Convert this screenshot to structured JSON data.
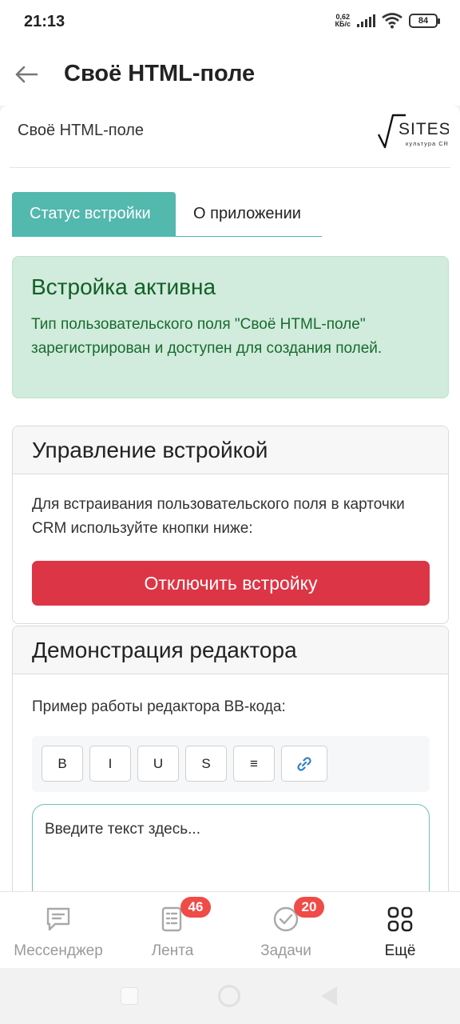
{
  "status_bar": {
    "time": "21:13",
    "net_speed_value": "0,62",
    "net_speed_unit": "КБ/с",
    "battery": "84"
  },
  "header": {
    "title": "Своё HTML-поле"
  },
  "app": {
    "name": "Своё HTML-поле",
    "logo_text": "SITES",
    "logo_subtext": "культура CRM"
  },
  "tabs": [
    {
      "label": "Статус встройки",
      "active": true
    },
    {
      "label": "О приложении",
      "active": false
    }
  ],
  "alert": {
    "title": "Встройка активна",
    "text": "Тип пользовательского поля \"Своё HTML-поле\" зарегистрирован и доступен для создания полей."
  },
  "manage_card": {
    "title": "Управление встройкой",
    "text": "Для встраивания пользовательского поля в карточки CRM используйте кнопки ниже:",
    "button": "Отключить встройку"
  },
  "demo_card": {
    "title": "Демонстрация редактора",
    "text": "Пример работы редактора BB-кода:",
    "toolbar": [
      "B",
      "I",
      "U",
      "S",
      "≡",
      "🔗"
    ],
    "placeholder": "Введите текст здесь..."
  },
  "bottom_nav": [
    {
      "label": "Мессенджер",
      "icon": "chat-icon",
      "badge": ""
    },
    {
      "label": "Лента",
      "icon": "feed-icon",
      "badge": "46"
    },
    {
      "label": "Задачи",
      "icon": "tasks-icon",
      "badge": "20"
    },
    {
      "label": "Ещё",
      "icon": "grid-icon",
      "badge": ""
    }
  ],
  "colors": {
    "accent": "#53b8ae",
    "danger": "#dc3545",
    "success_bg": "#d1ebdc",
    "badge": "#ef4b47"
  }
}
